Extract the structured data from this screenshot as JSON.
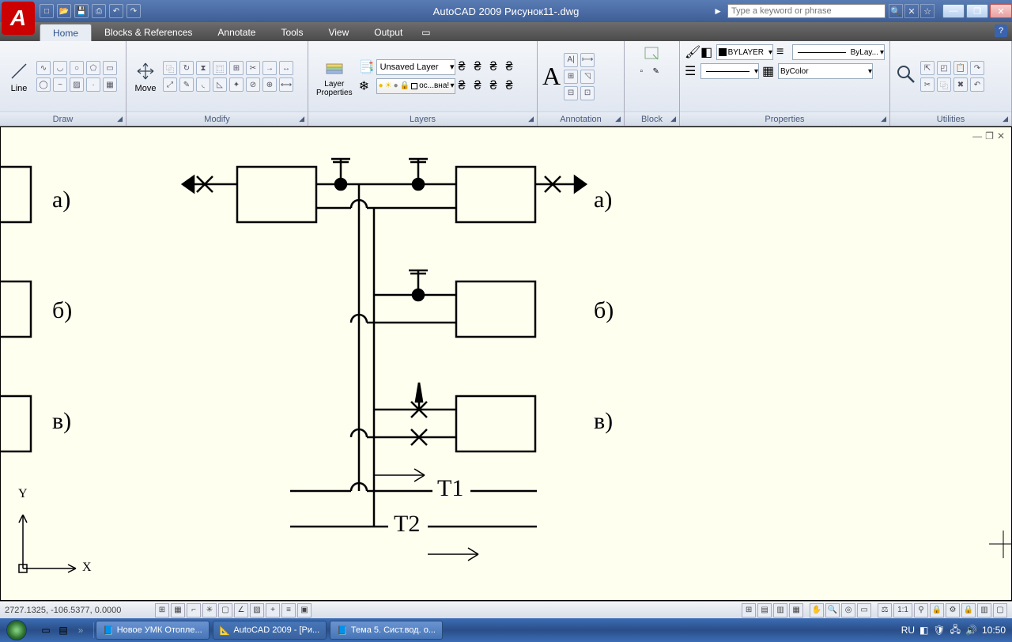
{
  "title_bar": {
    "app_letter": "A",
    "title": "AutoCAD 2009 Рисунок11-.dwg",
    "search_placeholder": "Type a keyword or phrase"
  },
  "tabs": {
    "home": "Home",
    "blocks": "Blocks & References",
    "annotate": "Annotate",
    "tools": "Tools",
    "view": "View",
    "output": "Output"
  },
  "ribbon": {
    "draw": {
      "label": "Draw",
      "line": "Line"
    },
    "modify": {
      "label": "Modify",
      "move": "Move"
    },
    "layers": {
      "label": "Layers",
      "properties": "Layer\nProperties",
      "unsaved": "Unsaved Layer",
      "layer_status": "ос...вна!"
    },
    "annotation": {
      "label": "Annotation"
    },
    "block": {
      "label": "Block"
    },
    "properties": {
      "label": "Properties",
      "bylayer": "BYLAYER",
      "bylay": "ByLay...",
      "bycolor": "ByColor"
    },
    "utilities": {
      "label": "Utilities"
    }
  },
  "drawing": {
    "labels": {
      "a_left": "а)",
      "a_right": "а)",
      "b_left": "б)",
      "b_right": "б)",
      "v_left": "в)",
      "v_right": "в)",
      "t1": "Т1",
      "t2": "Т2",
      "x": "X",
      "y": "Y"
    }
  },
  "status": {
    "coords": "2727.1325, -106.5377, 0.0000",
    "scale": "1:1"
  },
  "taskbar": {
    "btn1": "Новое УМК Отопле...",
    "btn2": "AutoCAD 2009 - [Ри...",
    "btn3": "Тема 5. Сист.вод. о...",
    "lang": "RU",
    "time": "10:50"
  }
}
